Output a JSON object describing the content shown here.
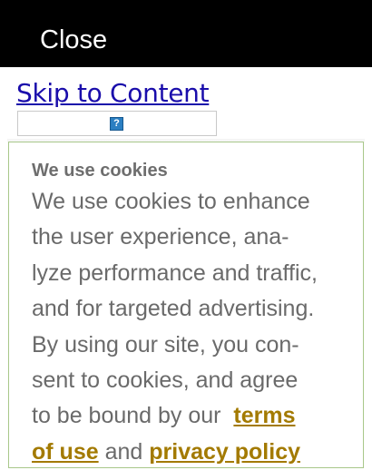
{
  "header": {
    "close_label": "Close"
  },
  "skip_link": {
    "label": "Skip to Content"
  },
  "help": {
    "icon_glyph": "?"
  },
  "cookie_banner": {
    "title": "We use cookies",
    "lines": [
      "We use cookies to enhance",
      "the user experience, ana-",
      "lyze performance and traffic,",
      "and for targeted advertising.",
      "By using our site, you con-",
      "sent to cookies, and agree",
      "to be bound by our"
    ],
    "terms_link_part1": "terms",
    "terms_link_part2": "of use",
    "and_text": "and",
    "privacy_link": "privacy policy",
    "link_color": "#a37a00"
  }
}
